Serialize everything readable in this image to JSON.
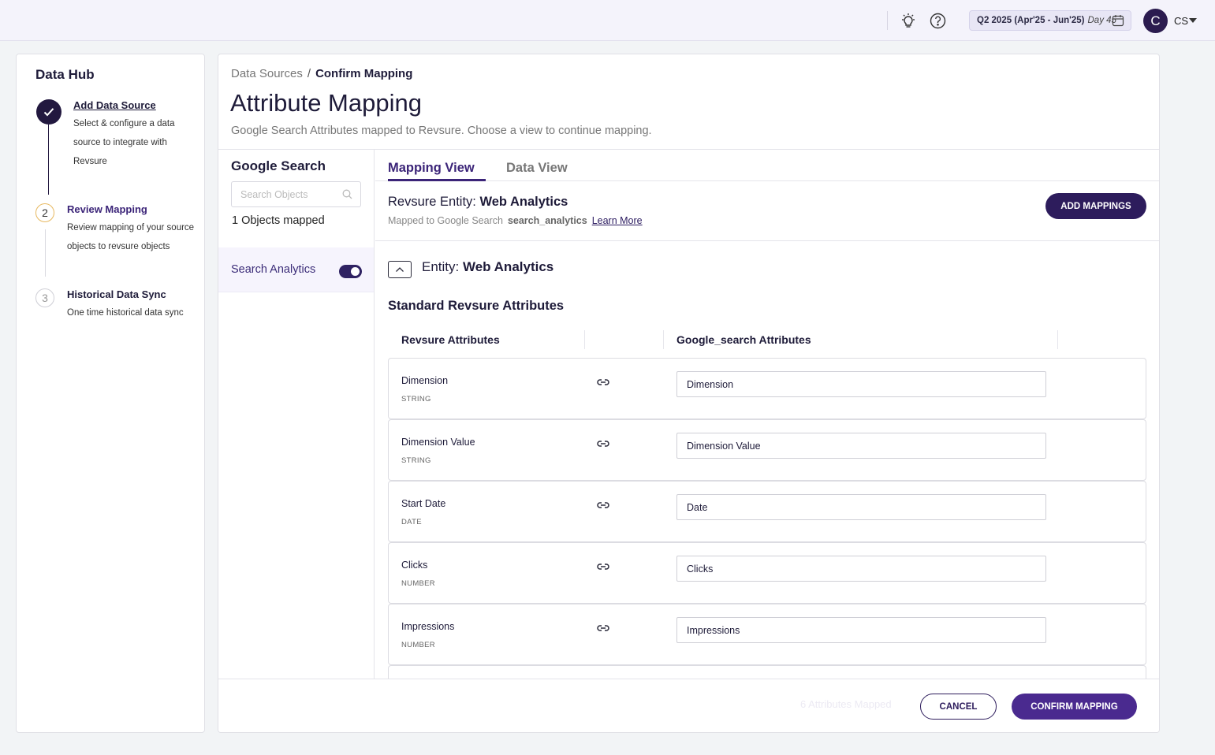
{
  "topbar": {
    "period_label": "Q2 2025 (Apr'25 - Jun'25)",
    "period_day": "Day 45",
    "avatar_initial": "C",
    "user_initials": "CS"
  },
  "stepper": {
    "title": "Data Hub",
    "steps": [
      {
        "number": "",
        "title": "Add Data Source",
        "description": "Select & configure a data source to integrate with Revsure",
        "state": "completed"
      },
      {
        "number": "2",
        "title": "Review Mapping",
        "description": "Review mapping of your source objects to revsure objects",
        "state": "active"
      },
      {
        "number": "3",
        "title": "Historical Data Sync",
        "description": "One time historical data sync",
        "state": "pending"
      }
    ]
  },
  "breadcrumb": {
    "parent": "Data Sources",
    "separator": "/",
    "current": "Confirm Mapping"
  },
  "header": {
    "title": "Attribute Mapping",
    "subtitle": "Google Search Attributes mapped to Revsure. Choose a view to continue mapping."
  },
  "objects_panel": {
    "title": "Google Search",
    "search_placeholder": "Search Objects",
    "mapped_count": "1 Objects mapped",
    "items": [
      {
        "label": "Search Analytics",
        "enabled": true
      }
    ]
  },
  "tabs": [
    {
      "label": "Mapping View",
      "active": true
    },
    {
      "label": "Data View",
      "active": false
    }
  ],
  "entity_header": {
    "prefix": "Revsure Entity:",
    "name": "Web Analytics",
    "mapped_to_label": "Mapped to Google Search",
    "source_table": "search_analytics",
    "learn_more": "Learn More",
    "add_button": "ADD MAPPINGS"
  },
  "entity_section": {
    "prefix": "Entity:",
    "name": "Web Analytics",
    "section_title": "Standard Revsure Attributes",
    "col_revsure": "Revsure Attributes",
    "col_source": "Google_search Attributes"
  },
  "attributes": [
    {
      "name": "Dimension",
      "type": "STRING",
      "mapped": "Dimension"
    },
    {
      "name": "Dimension Value",
      "type": "STRING",
      "mapped": "Dimension Value"
    },
    {
      "name": "Start Date",
      "type": "DATE",
      "mapped": "Date"
    },
    {
      "name": "Clicks",
      "type": "NUMBER",
      "mapped": "Clicks"
    },
    {
      "name": "Impressions",
      "type": "NUMBER",
      "mapped": "Impressions"
    },
    {
      "name": "",
      "type": "",
      "mapped": ""
    }
  ],
  "footer": {
    "mapped_count": "6 Attributes Mapped",
    "cancel": "CANCEL",
    "confirm": "CONFIRM MAPPING"
  },
  "colors": {
    "brand_dark": "#2d1c5c",
    "brand_primary": "#4a2a8f",
    "step_active": "#3b2478",
    "step_pending_border": "#e7b85f"
  },
  "icons": {
    "theme": "sun-icon",
    "help": "help-circle-icon",
    "calendar": "calendar-icon",
    "search": "search-icon",
    "link": "link-icon",
    "collapse": "chevron-up-icon",
    "check": "check-icon",
    "dropdown": "caret-down-icon"
  }
}
